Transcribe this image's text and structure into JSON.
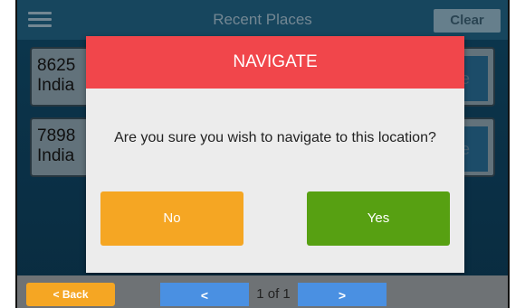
{
  "header": {
    "title": "Recent Places",
    "clear_label": "Clear"
  },
  "places": [
    {
      "line1": "8625",
      "line2": "India",
      "action_fragment": "e"
    },
    {
      "line1": "7898",
      "line2": "India",
      "action_fragment": "e"
    }
  ],
  "dialog": {
    "title": "NAVIGATE",
    "message": "Are you sure you wish to navigate to this location?",
    "no_label": "No",
    "yes_label": "Yes"
  },
  "footer": {
    "back_label": "< Back",
    "prev_label": "<",
    "next_label": ">",
    "page_indicator": "1 of 1"
  },
  "colors": {
    "dialog_header": "#f1464b",
    "no_button": "#f5a623",
    "yes_button": "#57a012",
    "nav_button": "#4a90e2",
    "back_button": "#f5a623"
  }
}
